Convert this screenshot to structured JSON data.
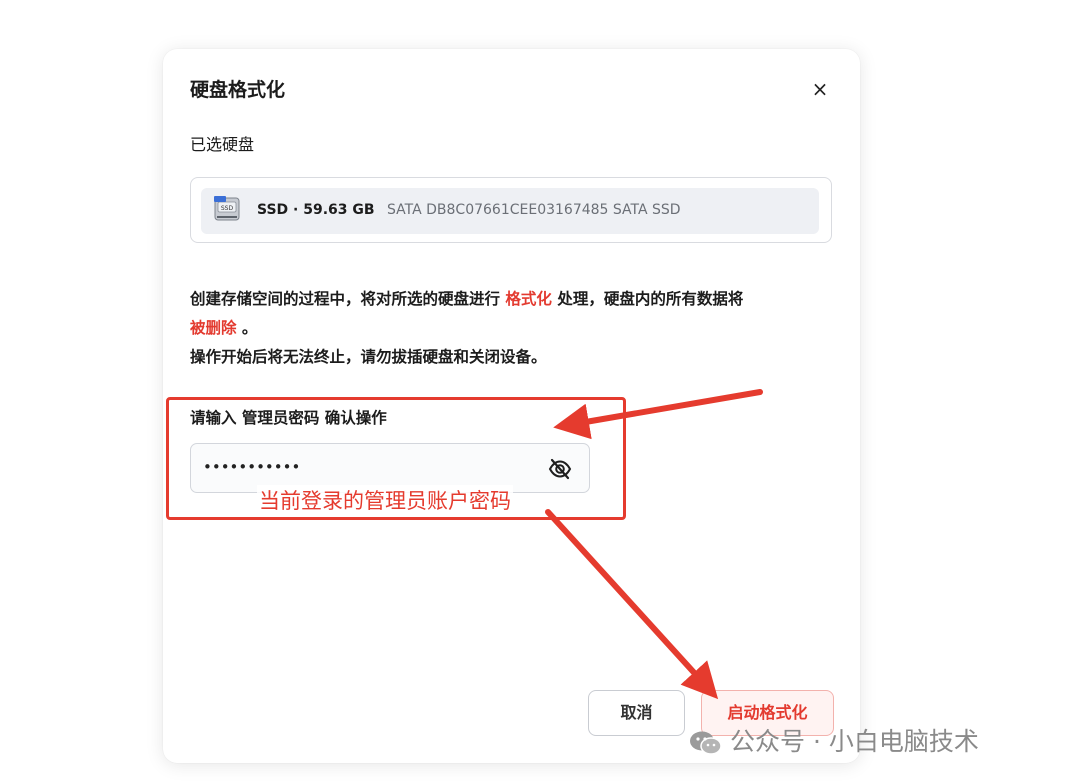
{
  "dialog": {
    "title": "硬盘格式化",
    "close_symbol": "×",
    "selected_label": "已选硬盘",
    "disk": {
      "icon": "ssd-disk-icon",
      "name": "SSD · 59.63 GB",
      "meta": "SATA  DB8C07661CEE03167485  SATA SSD"
    },
    "warning": {
      "part1": "创建存储空间的过程中，将对所选的硬盘进行 ",
      "highlight1": "格式化",
      "part2": " 处理，硬盘内的所有数据将",
      "highlight2": "被删除",
      "part3": " 。",
      "line2": "操作开始后将无法终止，请勿拔插硬盘和关闭设备。"
    },
    "password": {
      "label": "请输入 管理员密码 确认操作",
      "value": "•••••••••••",
      "toggle_icon": "eye-off-icon"
    },
    "buttons": {
      "cancel": "取消",
      "start": "启动格式化"
    }
  },
  "annotation": {
    "text": "当前登录的管理员账户密码",
    "color": "#e53b2e"
  },
  "watermark": {
    "text": "公众号 · 小白电脑技术",
    "icon": "wechat-icon"
  },
  "colors": {
    "accent_red": "#e33a2f"
  }
}
